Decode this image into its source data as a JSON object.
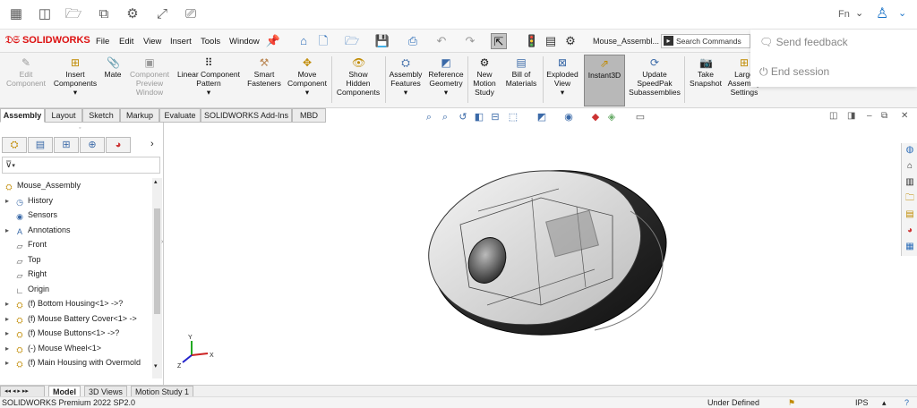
{
  "host": {
    "fn_label": "Fn",
    "icons": [
      "dashboard-icon",
      "tabs-icon",
      "folder-icon",
      "copy-icon",
      "settings-icon",
      "fullscreen-icon",
      "share-screen-icon"
    ],
    "popup": {
      "feedback": "Send feedback",
      "end_session": "End session"
    }
  },
  "app": {
    "logo": "SOLIDWORKS",
    "menus": [
      "File",
      "Edit",
      "View",
      "Insert",
      "Tools",
      "Window"
    ],
    "doc_name": "Mouse_Assembl...",
    "search_placeholder": "Search Commands"
  },
  "command_manager": [
    {
      "label": "Edit\nComponent",
      "icon": "edit-component-icon",
      "disabled": true
    },
    {
      "label": "Insert\nComponents",
      "icon": "insert-components-icon",
      "disabled": false
    },
    {
      "label": "Mate",
      "icon": "mate-icon",
      "disabled": false
    },
    {
      "label": "Component\nPreview\nWindow",
      "icon": "preview-window-icon",
      "disabled": true
    },
    {
      "label": "Linear Component\nPattern",
      "icon": "pattern-icon",
      "disabled": false
    },
    {
      "label": "Smart\nFasteners",
      "icon": "fasteners-icon",
      "disabled": false
    },
    {
      "label": "Move\nComponent",
      "icon": "move-component-icon",
      "disabled": false
    },
    {
      "label": "Show\nHidden\nComponents",
      "icon": "show-hidden-icon",
      "disabled": false
    },
    {
      "label": "Assembly\nFeatures",
      "icon": "assembly-features-icon",
      "disabled": false
    },
    {
      "label": "Reference\nGeometry",
      "icon": "reference-geometry-icon",
      "disabled": false
    },
    {
      "label": "New\nMotion\nStudy",
      "icon": "motion-study-icon",
      "disabled": false
    },
    {
      "label": "Bill of\nMaterials",
      "icon": "bom-icon",
      "disabled": false
    },
    {
      "label": "Exploded\nView",
      "icon": "exploded-view-icon",
      "disabled": false
    },
    {
      "label": "Instant3D",
      "icon": "instant3d-icon",
      "disabled": false,
      "active": true
    },
    {
      "label": "Update\nSpeedPak\nSubassemblies",
      "icon": "speedpak-icon",
      "disabled": false
    },
    {
      "label": "Take\nSnapshot",
      "icon": "snapshot-icon",
      "disabled": false
    },
    {
      "label": "Large\nAssembly\nSettings",
      "icon": "large-assembly-icon",
      "disabled": false
    }
  ],
  "tabs": [
    "Assembly",
    "Layout",
    "Sketch",
    "Markup",
    "Evaluate",
    "SOLIDWORKS Add-Ins",
    "MBD"
  ],
  "tree": [
    {
      "label": "Mouse_Assembly",
      "level": 0,
      "arrow": false,
      "icon": "assembly-icon"
    },
    {
      "label": "History",
      "level": 1,
      "arrow": true,
      "icon": "history-icon"
    },
    {
      "label": "Sensors",
      "level": 1,
      "arrow": false,
      "icon": "sensors-icon"
    },
    {
      "label": "Annotations",
      "level": 1,
      "arrow": true,
      "icon": "annotations-icon"
    },
    {
      "label": "Front",
      "level": 1,
      "arrow": false,
      "icon": "plane-icon"
    },
    {
      "label": "Top",
      "level": 1,
      "arrow": false,
      "icon": "plane-icon"
    },
    {
      "label": "Right",
      "level": 1,
      "arrow": false,
      "icon": "plane-icon"
    },
    {
      "label": "Origin",
      "level": 1,
      "arrow": false,
      "icon": "origin-icon"
    },
    {
      "label": "(f) Bottom Housing<1> ->?",
      "level": 1,
      "arrow": true,
      "icon": "part-icon"
    },
    {
      "label": "(f) Mouse Battery Cover<1> ->",
      "level": 1,
      "arrow": true,
      "icon": "part-icon"
    },
    {
      "label": "(f) Mouse Buttons<1> ->?",
      "level": 1,
      "arrow": true,
      "icon": "part-icon"
    },
    {
      "label": "(-) Mouse Wheel<1>",
      "level": 1,
      "arrow": true,
      "icon": "part-icon"
    },
    {
      "label": "(f) Main Housing with Overmold",
      "level": 1,
      "arrow": true,
      "icon": "part-icon"
    }
  ],
  "bottom_tabs": [
    "Model",
    "3D Views",
    "Motion Study 1"
  ],
  "status": {
    "left": "SOLIDWORKS Premium 2022 SP2.0",
    "state": "Under Defined",
    "units": "IPS"
  }
}
